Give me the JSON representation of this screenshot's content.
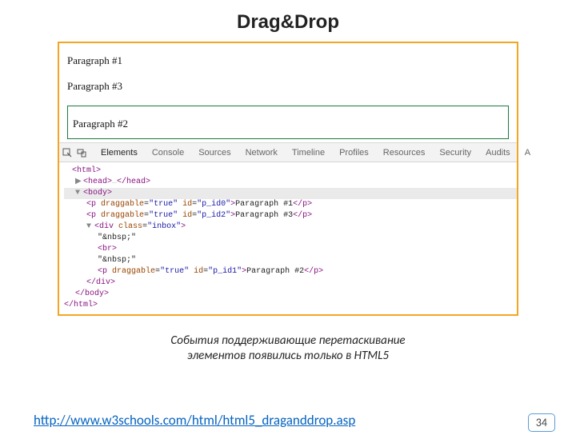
{
  "title": "Drag&Drop",
  "rendered": {
    "p1": "Paragraph #1",
    "p3": "Paragraph #3",
    "p2": "Paragraph #2"
  },
  "devtools": {
    "tabs": [
      "Elements",
      "Console",
      "Sources",
      "Network",
      "Timeline",
      "Profiles",
      "Resources",
      "Security",
      "Audits",
      "A"
    ],
    "lines": {
      "l0": "<html>",
      "l1_open": "<head>",
      "l1_mid": "…",
      "l1_close": "</head>",
      "l2": "<body>",
      "l3_a": "<p",
      "l3_attr1n": "draggable",
      "l3_attr1v": "\"true\"",
      "l3_attr2n": "id",
      "l3_attr2v": "\"p_id0\"",
      "l3_b": ">",
      "l3_txt": "Paragraph #1",
      "l3_c": "</p>",
      "l4_a": "<p",
      "l4_attr1n": "draggable",
      "l4_attr1v": "\"true\"",
      "l4_attr2n": "id",
      "l4_attr2v": "\"p_id2\"",
      "l4_b": ">",
      "l4_txt": "Paragraph #3",
      "l4_c": "</p>",
      "l5_a": "<div",
      "l5_attr1n": "class",
      "l5_attr1v": "\"inbox\"",
      "l5_b": ">",
      "l6": "\"&nbsp;\"",
      "l7": "<br>",
      "l8": "\"&nbsp;\"",
      "l9_a": "<p",
      "l9_attr1n": "draggable",
      "l9_attr1v": "\"true\"",
      "l9_attr2n": "id",
      "l9_attr2v": "\"p_id1\"",
      "l9_b": ">",
      "l9_txt": "Paragraph #2",
      "l9_c": "</p>",
      "l10": "</div>",
      "l11": "</body>",
      "l12": "</html>"
    }
  },
  "caption_line1": "События поддерживающие перетаскивание",
  "caption_line2": "элементов появились только в HTML5",
  "link": "http://www.w3schools.com/html/html5_draganddrop.asp",
  "slide_number": "34"
}
